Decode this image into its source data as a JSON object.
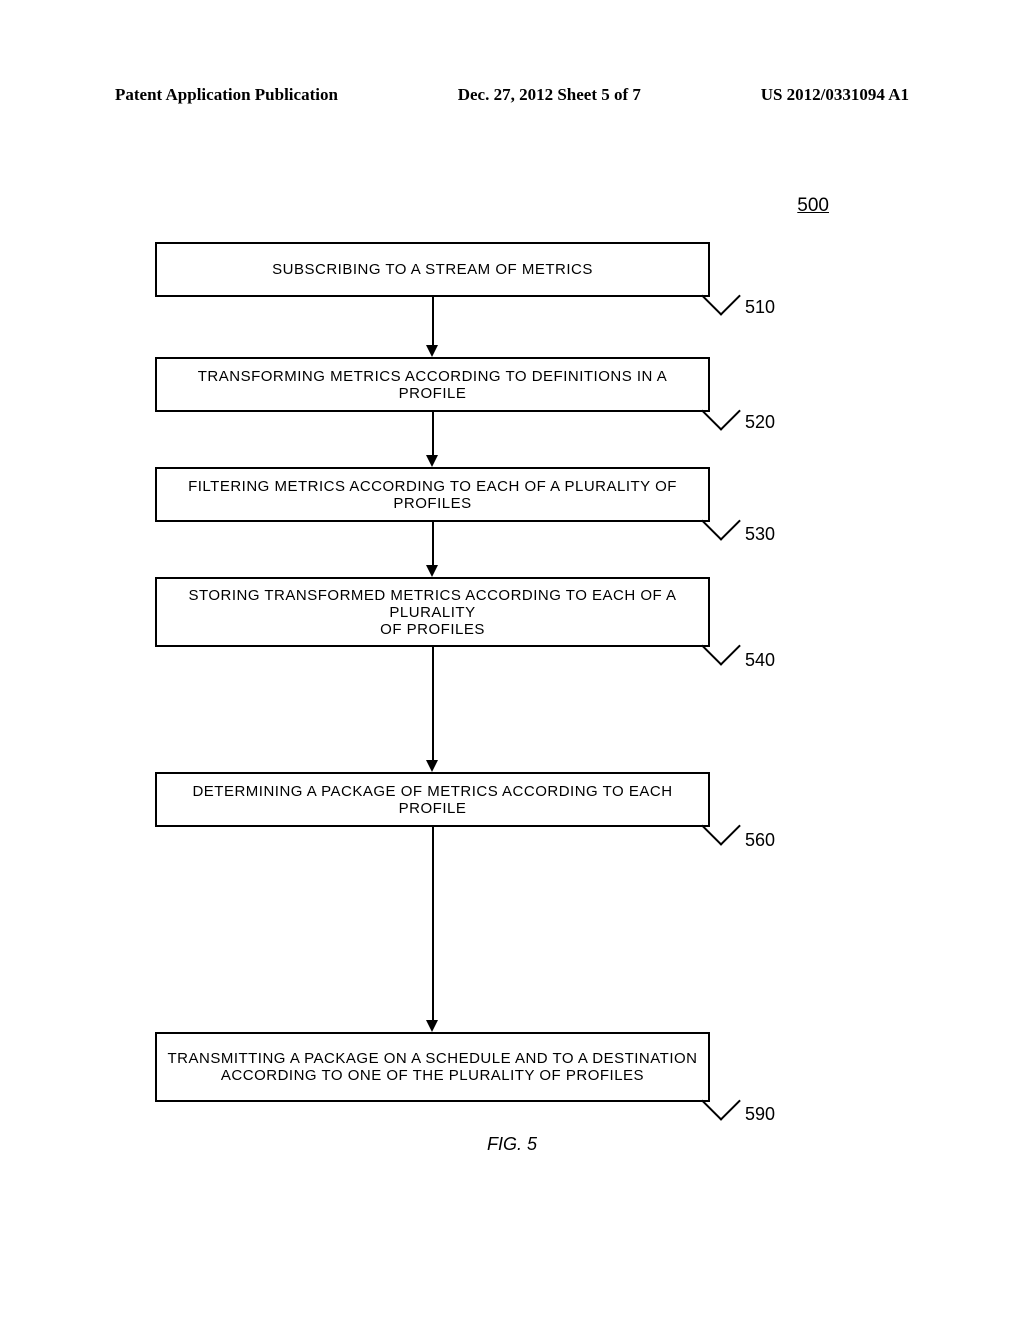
{
  "header": {
    "left": "Patent Application Publication",
    "center": "Dec. 27, 2012  Sheet 5 of 7",
    "right": "US 2012/0331094 A1"
  },
  "figure_number": "500",
  "boxes": [
    {
      "text": "SUBSCRIBING TO A STREAM OF METRICS",
      "ref": "510"
    },
    {
      "text": "TRANSFORMING METRICS ACCORDING TO DEFINITIONS IN A PROFILE",
      "ref": "520"
    },
    {
      "text": "FILTERING METRICS ACCORDING TO EACH OF A PLURALITY OF PROFILES",
      "ref": "530"
    },
    {
      "text_line1": "STORING TRANSFORMED METRICS ACCORDING TO EACH OF A PLURALITY",
      "text_line2": "OF PROFILES",
      "ref": "540"
    },
    {
      "text": "DETERMINING A PACKAGE OF METRICS ACCORDING TO EACH PROFILE",
      "ref": "560"
    },
    {
      "text_line1": "TRANSMITTING A PACKAGE ON A SCHEDULE AND TO A DESTINATION",
      "text_line2": "ACCORDING TO ONE OF THE PLURALITY OF PROFILES",
      "ref": "590"
    }
  ],
  "caption": "FIG. 5"
}
